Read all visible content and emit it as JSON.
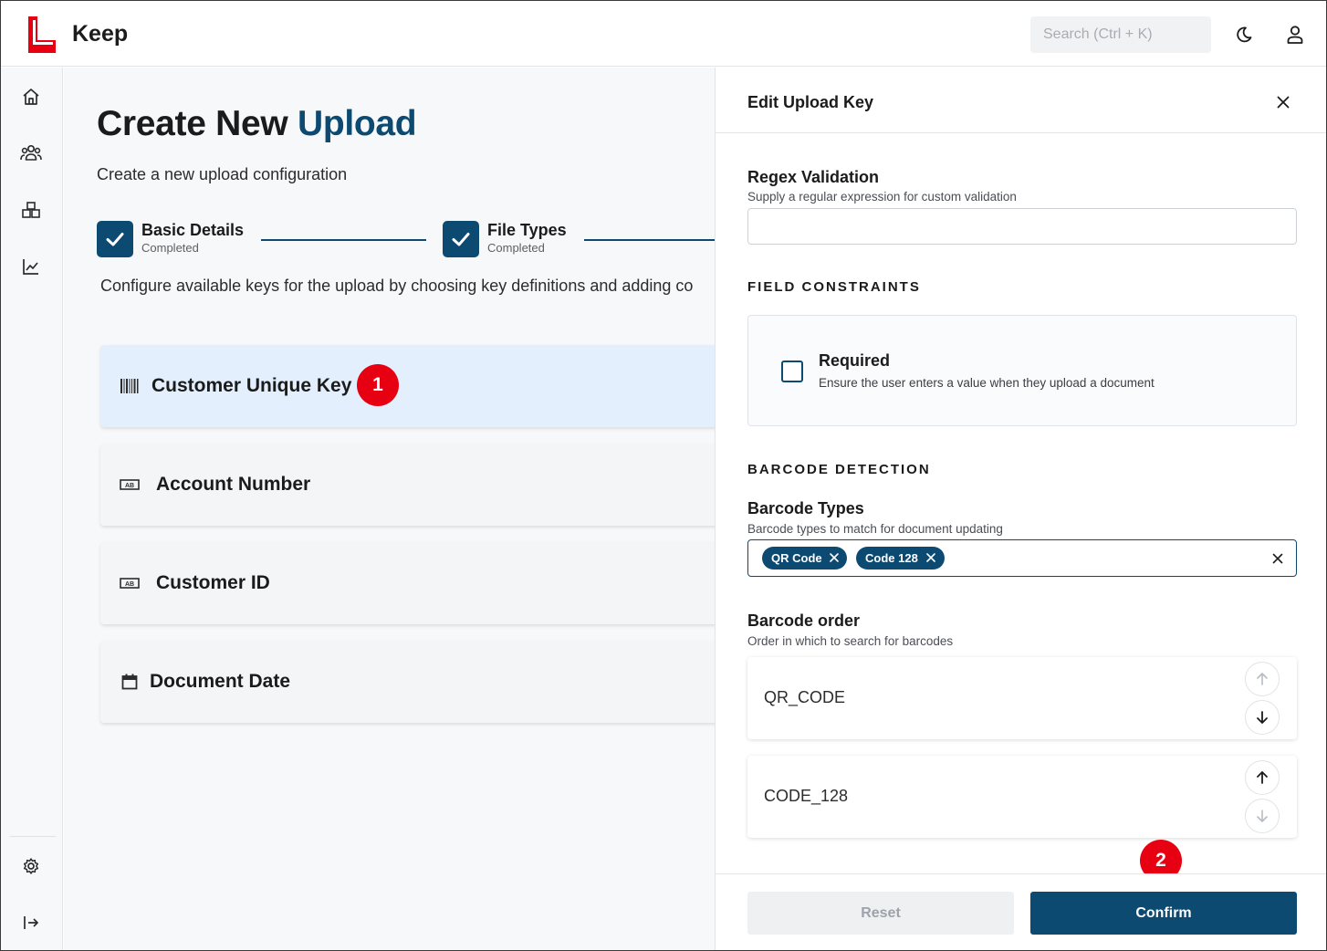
{
  "app": {
    "name": "Keep",
    "brand_color": "#e60012",
    "accent_color": "#0c4a72"
  },
  "header": {
    "search_placeholder": "Search (Ctrl + K)",
    "theme_icon": "moon-icon",
    "user_icon": "user-icon"
  },
  "sidebar": {
    "items": [
      {
        "icon": "home-icon"
      },
      {
        "icon": "users-icon"
      },
      {
        "icon": "boxes-icon"
      },
      {
        "icon": "chart-icon"
      }
    ],
    "bottom": [
      {
        "icon": "settings-icon"
      },
      {
        "icon": "collapse-icon"
      }
    ]
  },
  "main": {
    "title_prefix": "Create New ",
    "title_accent": "Upload",
    "subtitle": "Create a new upload configuration",
    "steps": [
      {
        "title": "Basic Details",
        "status": "Completed"
      },
      {
        "title": "File Types",
        "status": "Completed"
      }
    ],
    "config_text": "Configure available keys for the upload by choosing key definitions and adding co",
    "keys": [
      {
        "label": "Customer Unique Key",
        "icon": "barcode-icon"
      },
      {
        "label": "Account Number",
        "icon": "text-field-icon"
      },
      {
        "label": "Customer ID",
        "icon": "text-field-icon"
      },
      {
        "label": "Document Date",
        "icon": "calendar-icon"
      }
    ]
  },
  "markers": {
    "one": "1",
    "two": "2"
  },
  "panel": {
    "title": "Edit Upload Key",
    "regex": {
      "label": "Regex Validation",
      "hint": "Supply a regular expression for custom validation",
      "value": ""
    },
    "field_constraints": {
      "section": "FIELD CONSTRAINTS",
      "required_label": "Required",
      "required_hint": "Ensure the user enters a value when they upload a document",
      "required_checked": false
    },
    "barcode": {
      "section": "BARCODE DETECTION",
      "types_label": "Barcode Types",
      "types_hint": "Barcode types to match for document updating",
      "chips": [
        "QR Code",
        "Code 128"
      ],
      "order_label": "Barcode order",
      "order_hint": "Order in which to search for barcodes",
      "order": [
        "QR_CODE",
        "CODE_128"
      ]
    },
    "buttons": {
      "reset": "Reset",
      "confirm": "Confirm"
    }
  }
}
